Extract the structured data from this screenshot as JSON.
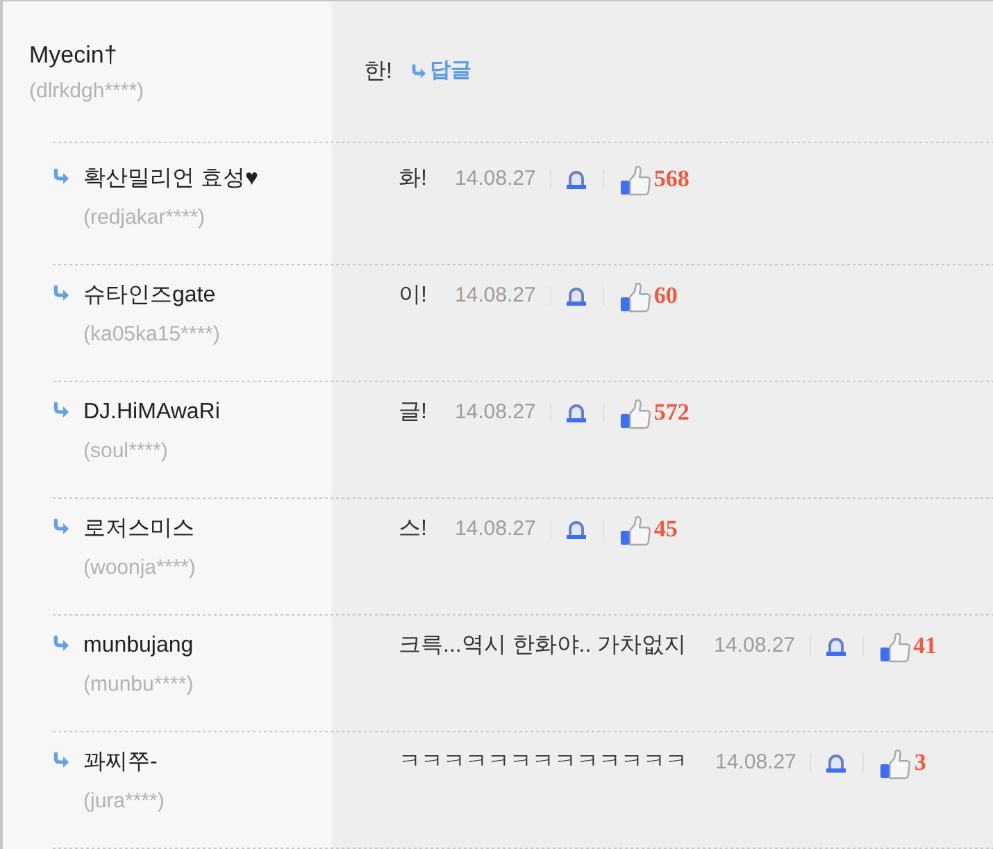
{
  "comment": {
    "author": "Myecin†",
    "user_id": "(dlrkdgh****)",
    "text": "한!",
    "reply_label": "답글"
  },
  "replies": [
    {
      "author": "확산밀리언 효성♥",
      "user_id": "(redjakar****)",
      "text": "화!",
      "date": "14.08.27",
      "likes": "568"
    },
    {
      "author": "슈타인즈gate",
      "user_id": "(ka05ka15****)",
      "text": "이!",
      "date": "14.08.27",
      "likes": "60"
    },
    {
      "author": "DJ.HiMAwaRi",
      "user_id": "(soul****)",
      "text": "글!",
      "date": "14.08.27",
      "likes": "572"
    },
    {
      "author": "로저스미스",
      "user_id": "(woonja****)",
      "text": "스!",
      "date": "14.08.27",
      "likes": "45"
    },
    {
      "author": "munbujang",
      "user_id": "(munbu****)",
      "text": "크륵...역시 한화야.. 가차없지",
      "date": "14.08.27",
      "likes": "41"
    },
    {
      "author": "꽈찌쭈-",
      "user_id": "(jura****)",
      "text": "ㅋㅋㅋㅋㅋㅋㅋㅋㅋㅋㅋㅋㅋ",
      "date": "14.08.27",
      "likes": "3"
    }
  ]
}
